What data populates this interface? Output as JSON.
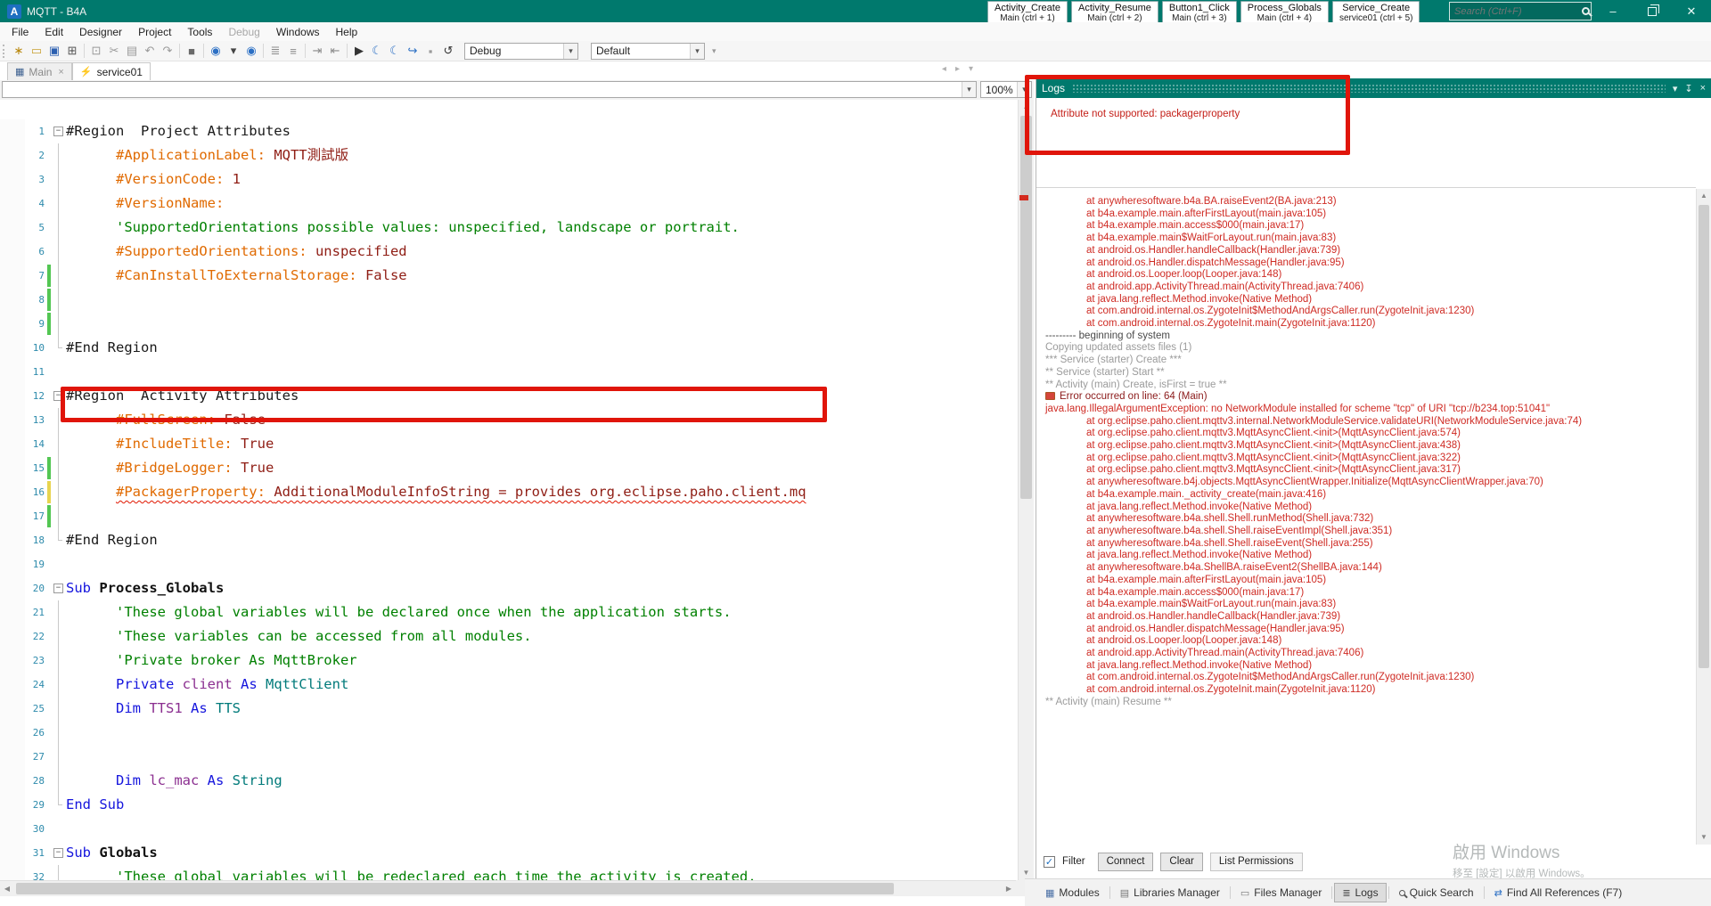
{
  "window": {
    "title": "MQTT - B4A",
    "logo": "A"
  },
  "titlebar": {
    "quick_buttons": [
      {
        "label": "Activity_Create",
        "sub": "Main  (ctrl + 1)"
      },
      {
        "label": "Activity_Resume",
        "sub": "Main  (ctrl + 2)"
      },
      {
        "label": "Button1_Click",
        "sub": "Main  (ctrl + 3)"
      },
      {
        "label": "Process_Globals",
        "sub": "Main  (ctrl + 4)"
      },
      {
        "label": "Service_Create",
        "sub": "service01  (ctrl + 5)"
      }
    ],
    "search_placeholder": "Search (Ctrl+F)"
  },
  "menus": [
    {
      "label": "File"
    },
    {
      "label": "Edit"
    },
    {
      "label": "Designer"
    },
    {
      "label": "Project"
    },
    {
      "label": "Tools"
    },
    {
      "label": "Debug",
      "disabled": true
    },
    {
      "label": "Windows"
    },
    {
      "label": "Help"
    }
  ],
  "toolbar": {
    "icons": [
      {
        "name": "new-project-icon",
        "glyph": "∗",
        "color": "#b8860b"
      },
      {
        "name": "open-project-icon",
        "glyph": "▭",
        "color": "#c8a132"
      },
      {
        "name": "save-icon",
        "glyph": "▣",
        "color": "#2b5fb0"
      },
      {
        "name": "package-icon",
        "glyph": "⊞",
        "color": "#555555"
      },
      {
        "sep": true
      },
      {
        "name": "copy-icon",
        "glyph": "⊡",
        "color": "#9a9a9a"
      },
      {
        "name": "cut-icon",
        "glyph": "✂",
        "color": "#9a9a9a"
      },
      {
        "name": "paste-icon",
        "glyph": "▤",
        "color": "#9a9a9a"
      },
      {
        "name": "undo-icon",
        "glyph": "↶",
        "color": "#9a9a9a"
      },
      {
        "name": "redo-icon",
        "glyph": "↷",
        "color": "#9a9a9a"
      },
      {
        "sep": true
      },
      {
        "name": "bookmark-icon",
        "glyph": "■",
        "color": "#6a6a6a"
      },
      {
        "sep": true
      },
      {
        "name": "compile-back-icon",
        "glyph": "◉",
        "color": "#2b6fc4"
      },
      {
        "name": "compile-menu-icon",
        "glyph": "▾",
        "color": "#444444"
      },
      {
        "name": "compile-run-icon",
        "glyph": "◉",
        "color": "#2b6fc4"
      },
      {
        "sep": true
      },
      {
        "name": "comment-icon",
        "glyph": "≣",
        "color": "#8a8a8a"
      },
      {
        "name": "uncomment-icon",
        "glyph": "≡",
        "color": "#8a8a8a"
      },
      {
        "sep": true
      },
      {
        "name": "indent-icon",
        "glyph": "⇥",
        "color": "#8a8a8a"
      },
      {
        "name": "outdent-icon",
        "glyph": "⇤",
        "color": "#8a8a8a"
      },
      {
        "sep": true
      },
      {
        "name": "run-icon",
        "glyph": "▶",
        "color": "#333333"
      },
      {
        "name": "breakpoint-toggle-icon",
        "glyph": "☾",
        "color": "#2b6fc4"
      },
      {
        "name": "breakpoint-clear-icon",
        "glyph": "☾",
        "color": "#2b6fc4"
      },
      {
        "name": "step-icon",
        "glyph": "↪",
        "color": "#2b6fc4"
      },
      {
        "name": "stop-icon",
        "glyph": "▪",
        "color": "#9a9a9a"
      },
      {
        "name": "restart-icon",
        "glyph": "↺",
        "color": "#333333"
      }
    ],
    "build_mode": "Debug",
    "build_configuration": "Default"
  },
  "tabs": [
    {
      "label": "Main",
      "active": true,
      "icon": "grid-icon",
      "glyph": "▦",
      "iconColor": "#3b5f8f",
      "closable": true
    },
    {
      "label": "service01",
      "active": false,
      "icon": "lightning-icon",
      "glyph": "⚡",
      "iconColor": "#e8a21c",
      "closable": false
    }
  ],
  "editor": {
    "nav_value": "",
    "zoom": "100%",
    "lines": [
      {
        "n": 1,
        "fold": "box",
        "segs": [
          {
            "t": "#Region  Project Attributes",
            "c": "p"
          }
        ]
      },
      {
        "n": 2,
        "fold": "line",
        "ind": true,
        "segs": [
          {
            "t": "#ApplicationLabel: ",
            "c": "a"
          },
          {
            "t": "MQTT測試版",
            "c": "v"
          }
        ]
      },
      {
        "n": 3,
        "fold": "line",
        "ind": true,
        "segs": [
          {
            "t": "#VersionCode: ",
            "c": "a"
          },
          {
            "t": "1",
            "c": "v"
          }
        ]
      },
      {
        "n": 4,
        "fold": "line",
        "ind": true,
        "segs": [
          {
            "t": "#VersionName: ",
            "c": "a"
          }
        ]
      },
      {
        "n": 5,
        "fold": "line",
        "ind": true,
        "segs": [
          {
            "t": "'SupportedOrientations possible values: unspecified, landscape or portrait.",
            "c": "c"
          }
        ]
      },
      {
        "n": 6,
        "fold": "line",
        "ind": true,
        "segs": [
          {
            "t": "#SupportedOrientations: ",
            "c": "a"
          },
          {
            "t": "unspecified",
            "c": "v"
          }
        ]
      },
      {
        "n": 7,
        "fold": "line",
        "ind": true,
        "bar": "g",
        "segs": [
          {
            "t": "#CanInstallToExternalStorage: ",
            "c": "a"
          },
          {
            "t": "False",
            "c": "v"
          }
        ]
      },
      {
        "n": 8,
        "fold": "line",
        "bar": "g",
        "segs": []
      },
      {
        "n": 9,
        "fold": "line",
        "bar": "g",
        "segs": []
      },
      {
        "n": 10,
        "fold": "end",
        "segs": [
          {
            "t": "#End Region",
            "c": "p"
          }
        ]
      },
      {
        "n": 11,
        "segs": []
      },
      {
        "n": 12,
        "fold": "box",
        "segs": [
          {
            "t": "#Region  Activity Attributes",
            "c": "p"
          }
        ]
      },
      {
        "n": 13,
        "fold": "line",
        "ind": true,
        "segs": [
          {
            "t": "#FullScreen: ",
            "c": "a"
          },
          {
            "t": "False",
            "c": "v"
          }
        ]
      },
      {
        "n": 14,
        "fold": "line",
        "ind": true,
        "segs": [
          {
            "t": "#IncludeTitle: ",
            "c": "a"
          },
          {
            "t": "True",
            "c": "v"
          }
        ]
      },
      {
        "n": 15,
        "fold": "line",
        "ind": true,
        "bar": "g",
        "segs": [
          {
            "t": "#BridgeLogger: ",
            "c": "a"
          },
          {
            "t": "True",
            "c": "v"
          }
        ]
      },
      {
        "n": 16,
        "fold": "line",
        "ind": true,
        "bar": "y",
        "squiggle": true,
        "segs": [
          {
            "t": "#PackagerProperty: ",
            "c": "a"
          },
          {
            "t": "AdditionalModuleInfoString = provides org.eclipse.paho.client.mq",
            "c": "v"
          }
        ]
      },
      {
        "n": 17,
        "fold": "line",
        "bar": "g",
        "segs": []
      },
      {
        "n": 18,
        "fold": "end",
        "segs": [
          {
            "t": "#End Region",
            "c": "p"
          }
        ]
      },
      {
        "n": 19,
        "segs": []
      },
      {
        "n": 20,
        "fold": "box",
        "segs": [
          {
            "t": "Sub ",
            "c": "k"
          },
          {
            "t": "Process_Globals",
            "c": "s"
          }
        ]
      },
      {
        "n": 21,
        "fold": "line",
        "ind": true,
        "segs": [
          {
            "t": "'These global variables will be declared once when the application starts.",
            "c": "c"
          }
        ]
      },
      {
        "n": 22,
        "fold": "line",
        "ind": true,
        "segs": [
          {
            "t": "'These variables can be accessed from all modules.",
            "c": "c"
          }
        ]
      },
      {
        "n": 23,
        "fold": "line",
        "ind": true,
        "segs": [
          {
            "t": "'Private broker As MqttBroker",
            "c": "c"
          }
        ]
      },
      {
        "n": 24,
        "fold": "line",
        "ind": true,
        "segs": [
          {
            "t": "Private ",
            "c": "k"
          },
          {
            "t": "client ",
            "c": "i"
          },
          {
            "t": "As ",
            "c": "k"
          },
          {
            "t": "MqttClient",
            "c": "t"
          }
        ]
      },
      {
        "n": 25,
        "fold": "line",
        "ind": true,
        "segs": [
          {
            "t": "Dim ",
            "c": "k"
          },
          {
            "t": "TTS1 ",
            "c": "i"
          },
          {
            "t": "As ",
            "c": "k"
          },
          {
            "t": "TTS",
            "c": "t"
          }
        ]
      },
      {
        "n": 26,
        "fold": "line",
        "segs": []
      },
      {
        "n": 27,
        "fold": "line",
        "segs": []
      },
      {
        "n": 28,
        "fold": "line",
        "ind": true,
        "segs": [
          {
            "t": "Dim ",
            "c": "k"
          },
          {
            "t": "lc_mac ",
            "c": "i"
          },
          {
            "t": "As ",
            "c": "k"
          },
          {
            "t": "String",
            "c": "t"
          }
        ]
      },
      {
        "n": 29,
        "fold": "end",
        "segs": [
          {
            "t": "End Sub",
            "c": "k"
          }
        ]
      },
      {
        "n": 30,
        "segs": []
      },
      {
        "n": 31,
        "fold": "box",
        "segs": [
          {
            "t": "Sub ",
            "c": "k"
          },
          {
            "t": "Globals",
            "c": "s"
          }
        ]
      },
      {
        "n": 32,
        "fold": "line",
        "ind": true,
        "segs": [
          {
            "t": "'These global variables will be redeclared each time the activity is created.",
            "c": "c"
          }
        ]
      }
    ]
  },
  "logs": {
    "title": "Logs",
    "message": "Attribute not supported: packagerproperty",
    "entries": [
      {
        "type": "trace",
        "text": "at anywheresoftware.b4a.BA.raiseEvent2(BA.java:213)"
      },
      {
        "type": "trace",
        "text": "at b4a.example.main.afterFirstLayout(main.java:105)"
      },
      {
        "type": "trace",
        "text": "at b4a.example.main.access$000(main.java:17)"
      },
      {
        "type": "trace",
        "text": "at b4a.example.main$WaitForLayout.run(main.java:83)"
      },
      {
        "type": "trace",
        "text": "at android.os.Handler.handleCallback(Handler.java:739)"
      },
      {
        "type": "trace",
        "text": "at android.os.Handler.dispatchMessage(Handler.java:95)"
      },
      {
        "type": "trace",
        "text": "at android.os.Looper.loop(Looper.java:148)"
      },
      {
        "type": "trace",
        "text": "at android.app.ActivityThread.main(ActivityThread.java:7406)"
      },
      {
        "type": "trace",
        "text": "at java.lang.reflect.Method.invoke(Native Method)"
      },
      {
        "type": "trace",
        "text": "at com.android.internal.os.ZygoteInit$MethodAndArgsCaller.run(ZygoteInit.java:1230)"
      },
      {
        "type": "trace",
        "text": "at com.android.internal.os.ZygoteInit.main(ZygoteInit.java:1120)"
      },
      {
        "type": "sys",
        "text": "--------- beginning of system"
      },
      {
        "type": "info",
        "text": "Copying updated assets files (1)"
      },
      {
        "type": "info",
        "text": "*** Service (starter) Create ***"
      },
      {
        "type": "info",
        "text": "** Service (starter) Start **"
      },
      {
        "type": "info",
        "text": "** Activity (main) Create, isFirst = true **"
      },
      {
        "type": "error",
        "text": "Error occurred on line: 64 (Main)"
      },
      {
        "type": "exception",
        "text": "java.lang.IllegalArgumentException: no NetworkModule installed for scheme \"tcp\" of URI \"tcp://b234.top:51041\""
      },
      {
        "type": "trace",
        "text": "at org.eclipse.paho.client.mqttv3.internal.NetworkModuleService.validateURI(NetworkModuleService.java:74)"
      },
      {
        "type": "trace",
        "text": "at org.eclipse.paho.client.mqttv3.MqttAsyncClient.<init>(MqttAsyncClient.java:574)"
      },
      {
        "type": "trace",
        "text": "at org.eclipse.paho.client.mqttv3.MqttAsyncClient.<init>(MqttAsyncClient.java:438)"
      },
      {
        "type": "trace",
        "text": "at org.eclipse.paho.client.mqttv3.MqttAsyncClient.<init>(MqttAsyncClient.java:322)"
      },
      {
        "type": "trace",
        "text": "at org.eclipse.paho.client.mqttv3.MqttAsyncClient.<init>(MqttAsyncClient.java:317)"
      },
      {
        "type": "trace",
        "text": "at anywheresoftware.b4j.objects.MqttAsyncClientWrapper.Initialize(MqttAsyncClientWrapper.java:70)"
      },
      {
        "type": "trace",
        "text": "at b4a.example.main._activity_create(main.java:416)"
      },
      {
        "type": "trace",
        "text": "at java.lang.reflect.Method.invoke(Native Method)"
      },
      {
        "type": "trace",
        "text": "at anywheresoftware.b4a.shell.Shell.runMethod(Shell.java:732)"
      },
      {
        "type": "trace",
        "text": "at anywheresoftware.b4a.shell.Shell.raiseEventImpl(Shell.java:351)"
      },
      {
        "type": "trace",
        "text": "at anywheresoftware.b4a.shell.Shell.raiseEvent(Shell.java:255)"
      },
      {
        "type": "trace",
        "text": "at java.lang.reflect.Method.invoke(Native Method)"
      },
      {
        "type": "trace",
        "text": "at anywheresoftware.b4a.ShellBA.raiseEvent2(ShellBA.java:144)"
      },
      {
        "type": "trace",
        "text": "at b4a.example.main.afterFirstLayout(main.java:105)"
      },
      {
        "type": "trace",
        "text": "at b4a.example.main.access$000(main.java:17)"
      },
      {
        "type": "trace",
        "text": "at b4a.example.main$WaitForLayout.run(main.java:83)"
      },
      {
        "type": "trace",
        "text": "at android.os.Handler.handleCallback(Handler.java:739)"
      },
      {
        "type": "trace",
        "text": "at android.os.Handler.dispatchMessage(Handler.java:95)"
      },
      {
        "type": "trace",
        "text": "at android.os.Looper.loop(Looper.java:148)"
      },
      {
        "type": "trace",
        "text": "at android.app.ActivityThread.main(ActivityThread.java:7406)"
      },
      {
        "type": "trace",
        "text": "at java.lang.reflect.Method.invoke(Native Method)"
      },
      {
        "type": "trace",
        "text": "at com.android.internal.os.ZygoteInit$MethodAndArgsCaller.run(ZygoteInit.java:1230)"
      },
      {
        "type": "trace",
        "text": "at com.android.internal.os.ZygoteInit.main(ZygoteInit.java:1120)"
      },
      {
        "type": "info",
        "text": "** Activity (main) Resume **"
      }
    ],
    "filter_label": "Filter",
    "filter_checked": true,
    "buttons": [
      "Connect",
      "Clear",
      "List Permissions"
    ]
  },
  "watermark": {
    "line1": "啟用 Windows",
    "line2": "移至 [設定] 以啟用 Windows。"
  },
  "bottombar": {
    "items": [
      {
        "label": "Modules",
        "icon": "modules-icon",
        "glyph": "▦",
        "color": "#4a6fa5"
      },
      {
        "label": "Libraries Manager",
        "icon": "libraries-manager-icon",
        "glyph": "▤",
        "color": "#777777"
      },
      {
        "label": "Files Manager",
        "icon": "files-manager-icon",
        "glyph": "▭",
        "color": "#777777"
      },
      {
        "label": "Logs",
        "icon": "logs-icon",
        "glyph": "≣",
        "color": "#555555",
        "active": true
      },
      {
        "label": "Quick Search",
        "icon": "search-icon",
        "glyph": "mag",
        "color": "#555555"
      },
      {
        "label": "Find All References (F7)",
        "icon": "find-references-icon",
        "glyph": "⇄",
        "color": "#2b6fc4"
      }
    ]
  },
  "colors": {
    "accent_teal": "#00796d",
    "annotation_red": "#e0150a",
    "log_red": "#cf2b24"
  }
}
